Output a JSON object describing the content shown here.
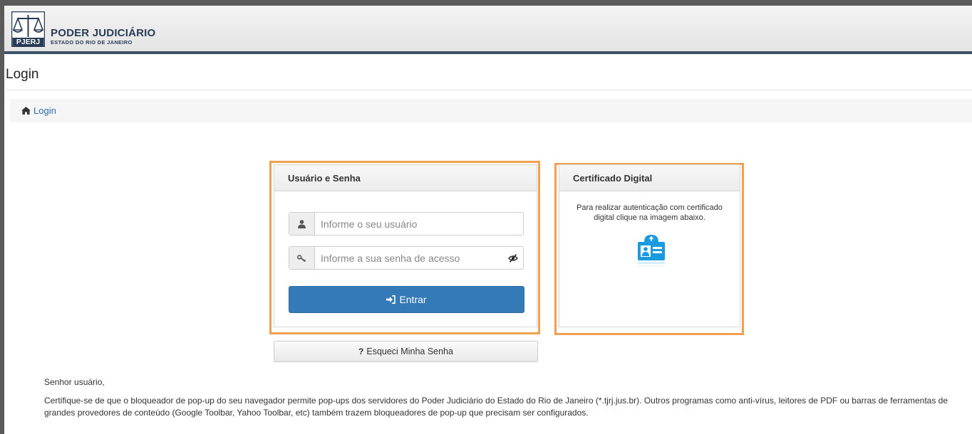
{
  "header": {
    "logo_mark": "PJERJ",
    "title": "PODER JUDICIÁRIO",
    "subtitle": "ESTADO DO RIO DE JANEIRO"
  },
  "page": {
    "title": "Login"
  },
  "breadcrumb": {
    "home_label": "Login"
  },
  "login_panel": {
    "heading": "Usuário e Senha",
    "username_placeholder": "Informe o seu usuário",
    "password_placeholder": "Informe a sua senha de acesso",
    "submit_label": "Entrar"
  },
  "forgot_button": {
    "label": "Esqueci Minha Senha"
  },
  "cert_panel": {
    "heading": "Certificado Digital",
    "text_line1": "Para realizar autenticação com certificado",
    "text_line2": "digital clique na imagem abaixo."
  },
  "notice": {
    "greeting": "Senhor usuário,",
    "body": "Certifique-se de que o bloqueador de pop-up do seu navegador permite pop-ups dos servidores do Poder Judiciário do Estado do Rio de Janeiro (*.tjrj.jus.br). Outros programas como anti-vírus, leitores de PDF ou barras de ferramentas de grandes provedores de conteúdo (Google Toolbar, Yahoo Toolbar, etc) também trazem bloqueadores de pop-up que precisam ser configurados."
  },
  "colors": {
    "highlight": "#f0a050",
    "primary": "#337ab7",
    "link": "#2a6fb3",
    "header_rule": "#3d5166"
  },
  "icons": [
    "scales-logo",
    "home-icon",
    "user-icon",
    "key-icon",
    "eye-slash-icon",
    "sign-in-icon",
    "question-icon",
    "certificate-card-icon"
  ]
}
